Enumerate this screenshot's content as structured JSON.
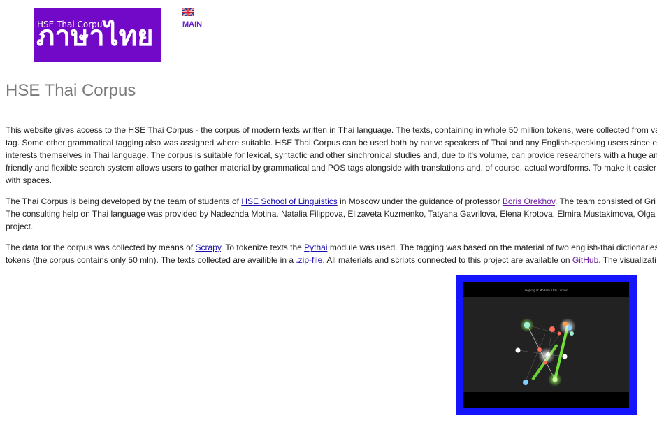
{
  "header": {
    "logo_small_text": "HSE Thai Corpus",
    "logo_thai_text": "ภาษาไทย",
    "nav_main_label": "MAIN",
    "language_flag": "uk-flag-icon"
  },
  "page": {
    "title": "HSE Thai Corpus"
  },
  "paragraph1": {
    "line1": "This website gives access to the HSE Thai Corpus - the corpus of modern texts written in Thai language. The texts, containing in whole 50 million tokens, were collected from va",
    "line2": "tag. Some other grammatical tagging also was assigned where suitable. HSE Thai Corpus can be used both by native speakers of Thai and any English-speaking users since e",
    "line3": "interests themselves in Thai language. The corpus is suitable for lexical, syntactic and other sinchronical studies and, due to it's volume, can provide researchers with a huge an",
    "line4": "friendly and flexible search system allows users to gather material by grammatical and POS tags alongside with translations and, of course, actual wordforms. To make it easier",
    "line5": "with spaces."
  },
  "paragraph2": {
    "l1_a": "The Thai Corpus is being developed by the team of students of ",
    "l1_link_hse": "HSE School of Linguistics",
    "l1_b": " in Moscow under the guidance of professor ",
    "l1_link_boris": "Boris Orekhov",
    "l1_c": ". The team consisted of Gri",
    "line2": "The consulting help on Thai language was provided by Nadezhda Motina. Natalia Filippova, Elizaveta Kuzmenko, Tatyana Gavrilova, Elena Krotova, Elmira Mustakimova, Olga",
    "line3": "project."
  },
  "paragraph3": {
    "l1_a": "The data for the corpus was collected by means of ",
    "l1_link_scrapy": "Scrapy",
    "l1_b": ". To tokenize texts the ",
    "l1_link_pythai": "Pythai",
    "l1_c": " module was used. The tagging was based on the material of two english-thai dictionaries",
    "l2_a": "tokens (the corpus contains only 50 mln). The texts collected are availible in a ",
    "l2_link_zip": ".zip-file",
    "l2_b": ". All materials and scripts connected to this project are available on ",
    "l2_link_github": "GitHub",
    "l2_c": ". The visualizati"
  },
  "visualization": {
    "caption": "Tagging of Modern Thai Corpus",
    "frame_color": "#1414ff",
    "background_color": "#222222",
    "node_colors": [
      "#9ff0d8",
      "#ff6b5a",
      "#80d0ff",
      "#c8ff9a",
      "#ffffff",
      "#ff9c4a"
    ],
    "accent_green": "#7dff3a"
  },
  "colors": {
    "logo_background": "#7209c9",
    "title_gray": "#7a7a7a",
    "link_blue": "#1a0dab",
    "link_visited": "#6c1aa3",
    "nav_purple": "#6a1fd1"
  }
}
